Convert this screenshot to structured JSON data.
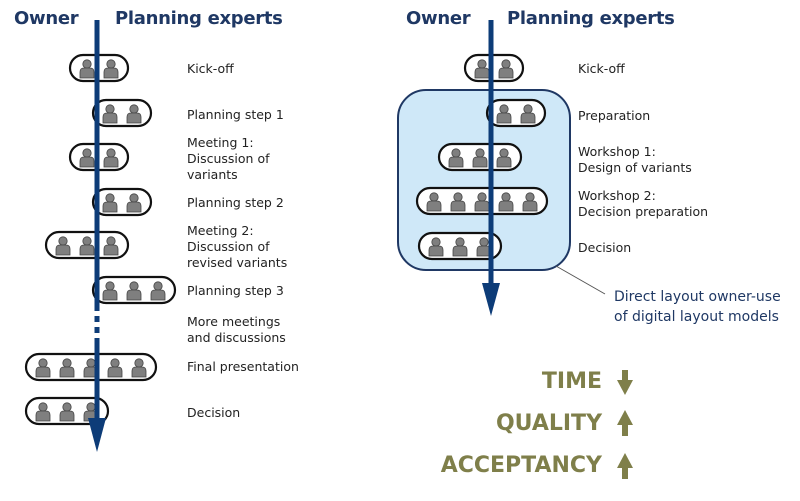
{
  "colors": {
    "arrow": "#0d3c78",
    "header": "#1f3864",
    "highlight_fill": "#cfe8f8",
    "highlight_stroke": "#1f3864",
    "person": "#7f7f7f",
    "metric": "#7f7f4a"
  },
  "left": {
    "owner_label": "Owner",
    "experts_label": "Planning experts",
    "steps": [
      {
        "label": "Kick-off",
        "people": 2
      },
      {
        "label": "Planning step 1",
        "people": 2
      },
      {
        "label": "Meeting 1:\nDiscussion of\nvariants",
        "people": 2
      },
      {
        "label": "Planning step 2",
        "people": 2
      },
      {
        "label": "Meeting 2:\nDiscussion of\nrevised variants",
        "people": 3
      },
      {
        "label": "Planning step 3",
        "people": 3
      },
      {
        "label": "More meetings\nand discussions",
        "people": 0
      },
      {
        "label": "Final presentation",
        "people": 5
      },
      {
        "label": "Decision",
        "people": 3
      }
    ]
  },
  "right": {
    "owner_label": "Owner",
    "experts_label": "Planning experts",
    "steps": [
      {
        "label": "Kick-off",
        "people": 2
      },
      {
        "label": "Preparation",
        "people": 2
      },
      {
        "label": "Workshop 1:\nDesign of variants",
        "people": 3
      },
      {
        "label": "Workshop 2:\nDecision preparation",
        "people": 5
      },
      {
        "label": "Decision",
        "people": 3
      }
    ],
    "callout": "Direct layout owner-use\nof digital layout models"
  },
  "metrics": [
    {
      "label": "TIME",
      "direction": "down"
    },
    {
      "label": "QUALITY",
      "direction": "up"
    },
    {
      "label": "ACCEPTANCY",
      "direction": "up"
    }
  ]
}
